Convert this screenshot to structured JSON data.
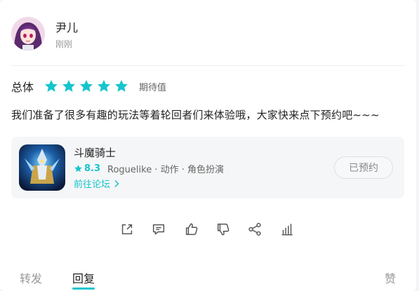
{
  "post": {
    "author": "尹儿",
    "time": "刚刚",
    "rating_label": "总体",
    "rating_value": 5,
    "rating_max": 5,
    "expect_label": "期待值",
    "content": "我们准备了很多有趣的玩法等着轮回者们来体验哦，大家快来点下预约吧~~~"
  },
  "game": {
    "title": "斗魔骑士",
    "score": "8.3",
    "tags": "Roguelike · 动作 · 角色扮演",
    "forum_link": "前往论坛",
    "reserve_button": "已预约"
  },
  "actions": [
    "share-icon",
    "comment-icon",
    "thumbs-up-icon",
    "thumbs-down-icon",
    "network-share-icon",
    "stats-icon"
  ],
  "tabs": {
    "repost": "转发",
    "reply": "回复",
    "like": "赞"
  },
  "colors": {
    "accent": "#15c5ce",
    "text": "#222222",
    "muted": "#999999"
  }
}
